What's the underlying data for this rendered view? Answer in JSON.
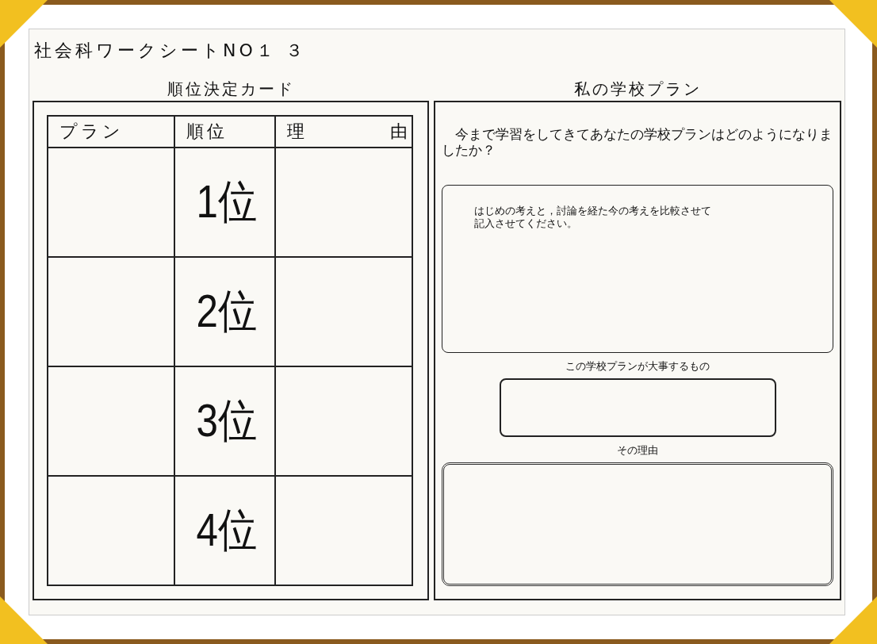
{
  "title": "社会科ワークシートNO１ ３",
  "ranking_card": {
    "heading": "順位決定カード",
    "columns": [
      "プラン",
      "順位",
      "理　　　　由"
    ],
    "rows": [
      {
        "rank": "1位"
      },
      {
        "rank": "2位"
      },
      {
        "rank": "3位"
      },
      {
        "rank": "4位"
      }
    ]
  },
  "school_plan": {
    "heading": "私の学校プラン",
    "question": "　今まで学習をしてきてあなたの学校プランはどのようになりましたか？",
    "note": "はじめの考えと，討論を経た今の考えを比較させて記入させてください。",
    "important_label": "この学校プランが大事するもの",
    "reason_label": "その理由"
  }
}
